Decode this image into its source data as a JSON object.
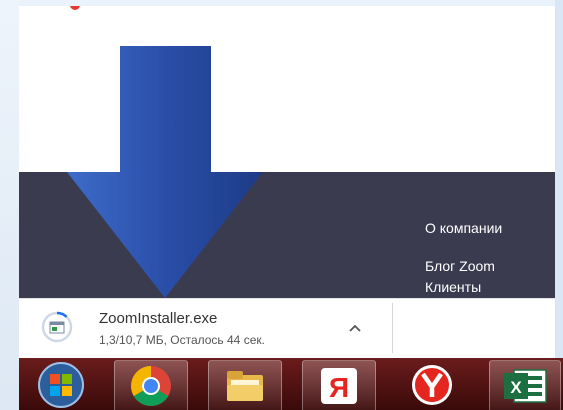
{
  "footer": {
    "links": [
      "О компании",
      "Блог Zoom",
      "Клиенты"
    ]
  },
  "download": {
    "filename": "ZoomInstaller.exe",
    "status": "1,3/10,7 МБ, Осталось 44 сек.",
    "progress_fraction": 0.12
  },
  "taskbar": {
    "items": [
      "start-orb-icon",
      "chrome-icon",
      "file-explorer-icon",
      "yandex-ya-icon",
      "yandex-browser-icon",
      "excel-icon"
    ]
  },
  "colors": {
    "footer_bg": "#3b3b4f",
    "arrow_blue": "#2a4fa8",
    "taskbar": "#4a0f0f"
  }
}
